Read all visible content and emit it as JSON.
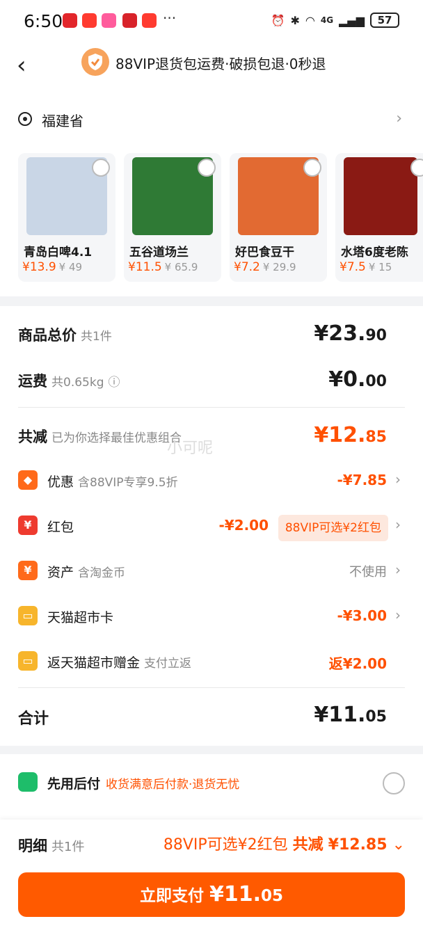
{
  "status_bar": {
    "time": "6:50",
    "dots": "···",
    "network": "4G",
    "battery": "57"
  },
  "header": {
    "back": "‹",
    "title": "88VIP退货包运费·破损包退·0秒退"
  },
  "address": {
    "text": "福建省"
  },
  "products": [
    {
      "name": "青岛白啤4.1",
      "price": "¥13.9",
      "orig": "¥ 49",
      "color": "#c9d6e6"
    },
    {
      "name": "五谷道场兰",
      "price": "¥11.5",
      "orig": "¥ 65.9",
      "color": "#2f7a35"
    },
    {
      "name": "好巴食豆干",
      "price": "¥7.2",
      "orig": "¥ 29.9",
      "color": "#e26a32"
    },
    {
      "name": "水塔6度老陈",
      "price": "¥7.5",
      "orig": "¥ 15",
      "color": "#8a1a14"
    }
  ],
  "summary": {
    "goods_total": {
      "label": "商品总价",
      "sub": "共1件",
      "amount_main": "¥23.",
      "amount_small": "90"
    },
    "shipping": {
      "label": "运费",
      "sub": "共0.65kg",
      "amount_main": "¥0.",
      "amount_small": "00"
    },
    "reduction": {
      "label": "共减",
      "sub": "已为你选择最佳优惠组合",
      "amount_main": "¥12.",
      "amount_small": "85"
    },
    "watermark": "小可呢",
    "lines": [
      {
        "label": "优惠",
        "sub": "含88VIP专享9.5折",
        "value": "-¥7.85",
        "icon_color": "#ff6a1a"
      },
      {
        "label": "红包",
        "sub": "",
        "value": "-¥2.00",
        "tag": "88VIP可选¥2红包",
        "icon_color": "#ee3b2f"
      },
      {
        "label": "资产",
        "sub": "含淘金币",
        "value": "不使用",
        "icon_color": "#ff6a1a"
      },
      {
        "label": "天猫超市卡",
        "sub": "",
        "value": "-¥3.00",
        "icon_color": "#f7b52c"
      },
      {
        "label": "返天猫超市赠金",
        "sub": "支付立返",
        "value": "返¥2.00",
        "icon_color": "#f7b52c"
      }
    ],
    "total": {
      "label": "合计",
      "amount_main": "¥11.",
      "amount_small": "05"
    }
  },
  "payment": {
    "label": "先用后付",
    "sub": "收货满意后付款·退货无忧"
  },
  "bottom": {
    "detail_label": "明细",
    "detail_sub": "共1件",
    "promo_text": "88VIP可选¥2红包",
    "reduce_label": "共减",
    "reduce_amount": "¥12.85",
    "pay_label": "立即支付",
    "pay_amount_main": "¥11.",
    "pay_amount_small": "05"
  }
}
